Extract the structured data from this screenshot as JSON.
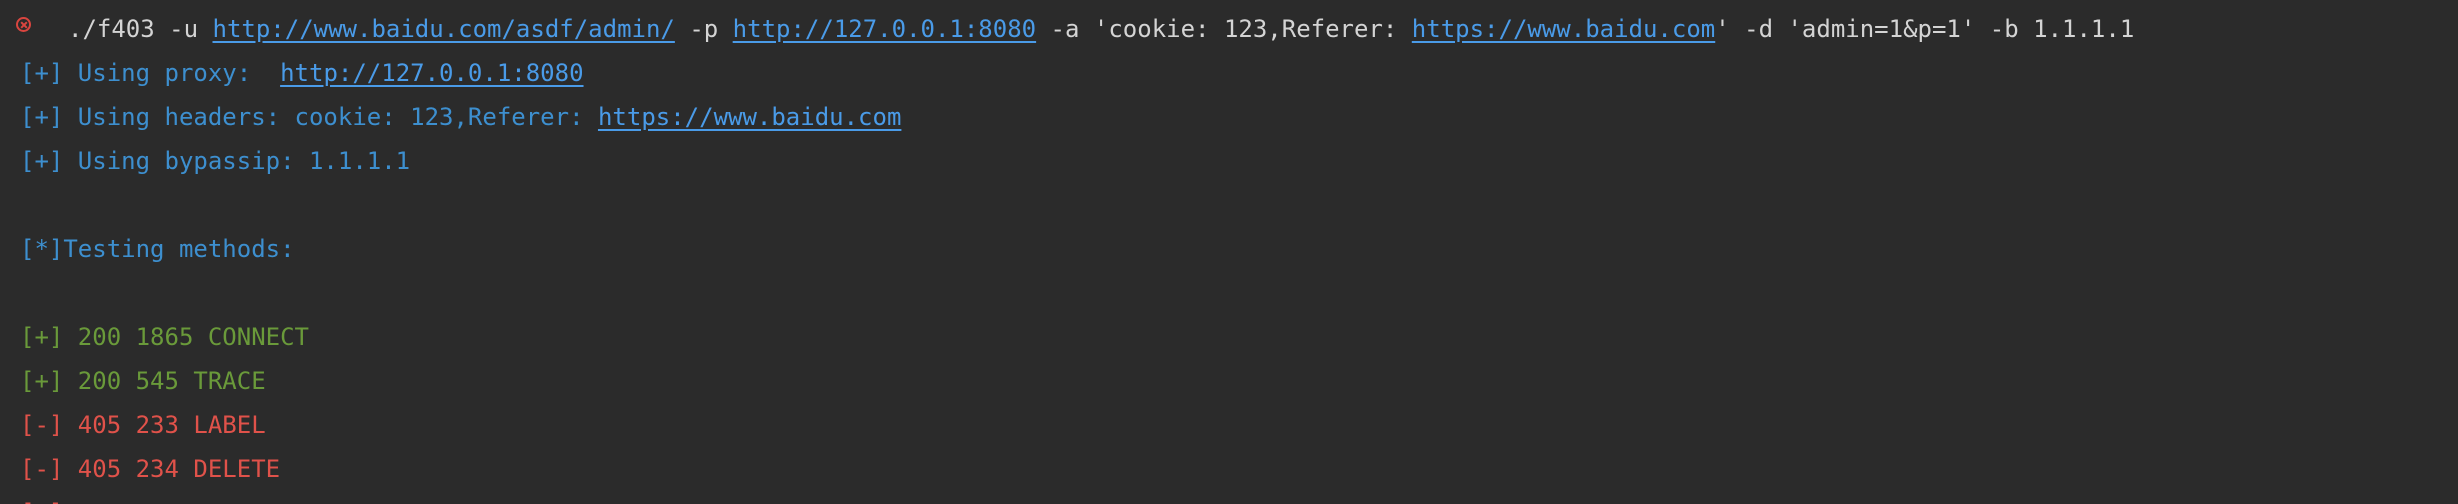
{
  "command": {
    "exit_status_icon": "error-circle-x-icon",
    "prefix": "./f403 -u ",
    "url": "http://www.baidu.com/asdf/admin/",
    "flag_p": " -p ",
    "proxy_url": "http://127.0.0.1:8080",
    "flag_a": " -a 'cookie: 123,Referer: ",
    "referer_url": "https://www.baidu.com",
    "rest": "' -d 'admin=1&p=1' -b 1.1.1.1"
  },
  "info_lines": {
    "proxy_label": "[+] Using proxy:  ",
    "proxy_value": "http://127.0.0.1:8080",
    "headers_label": "[+] Using headers: cookie: 123,Referer: ",
    "headers_value": "https://www.baidu.com",
    "bypassip": "[+] Using bypassip: 1.1.1.1",
    "testing": "[*]Testing methods:"
  },
  "results": [
    {
      "text": "[+] 200 1865 CONNECT",
      "status": "ok"
    },
    {
      "text": "[+] 200 545 TRACE",
      "status": "ok"
    },
    {
      "text": "[-] 405 233 LABEL",
      "status": "err"
    },
    {
      "text": "[-] 405 234 DELETE",
      "status": "err"
    },
    {
      "text": "[-]",
      "status": "err"
    }
  ],
  "colors": {
    "background": "#2b2b2b",
    "command_text": "#d4d4d4",
    "link": "#4a9be8",
    "info": "#3d8fcf",
    "success": "#6a9a3a",
    "error": "#e0524a"
  }
}
